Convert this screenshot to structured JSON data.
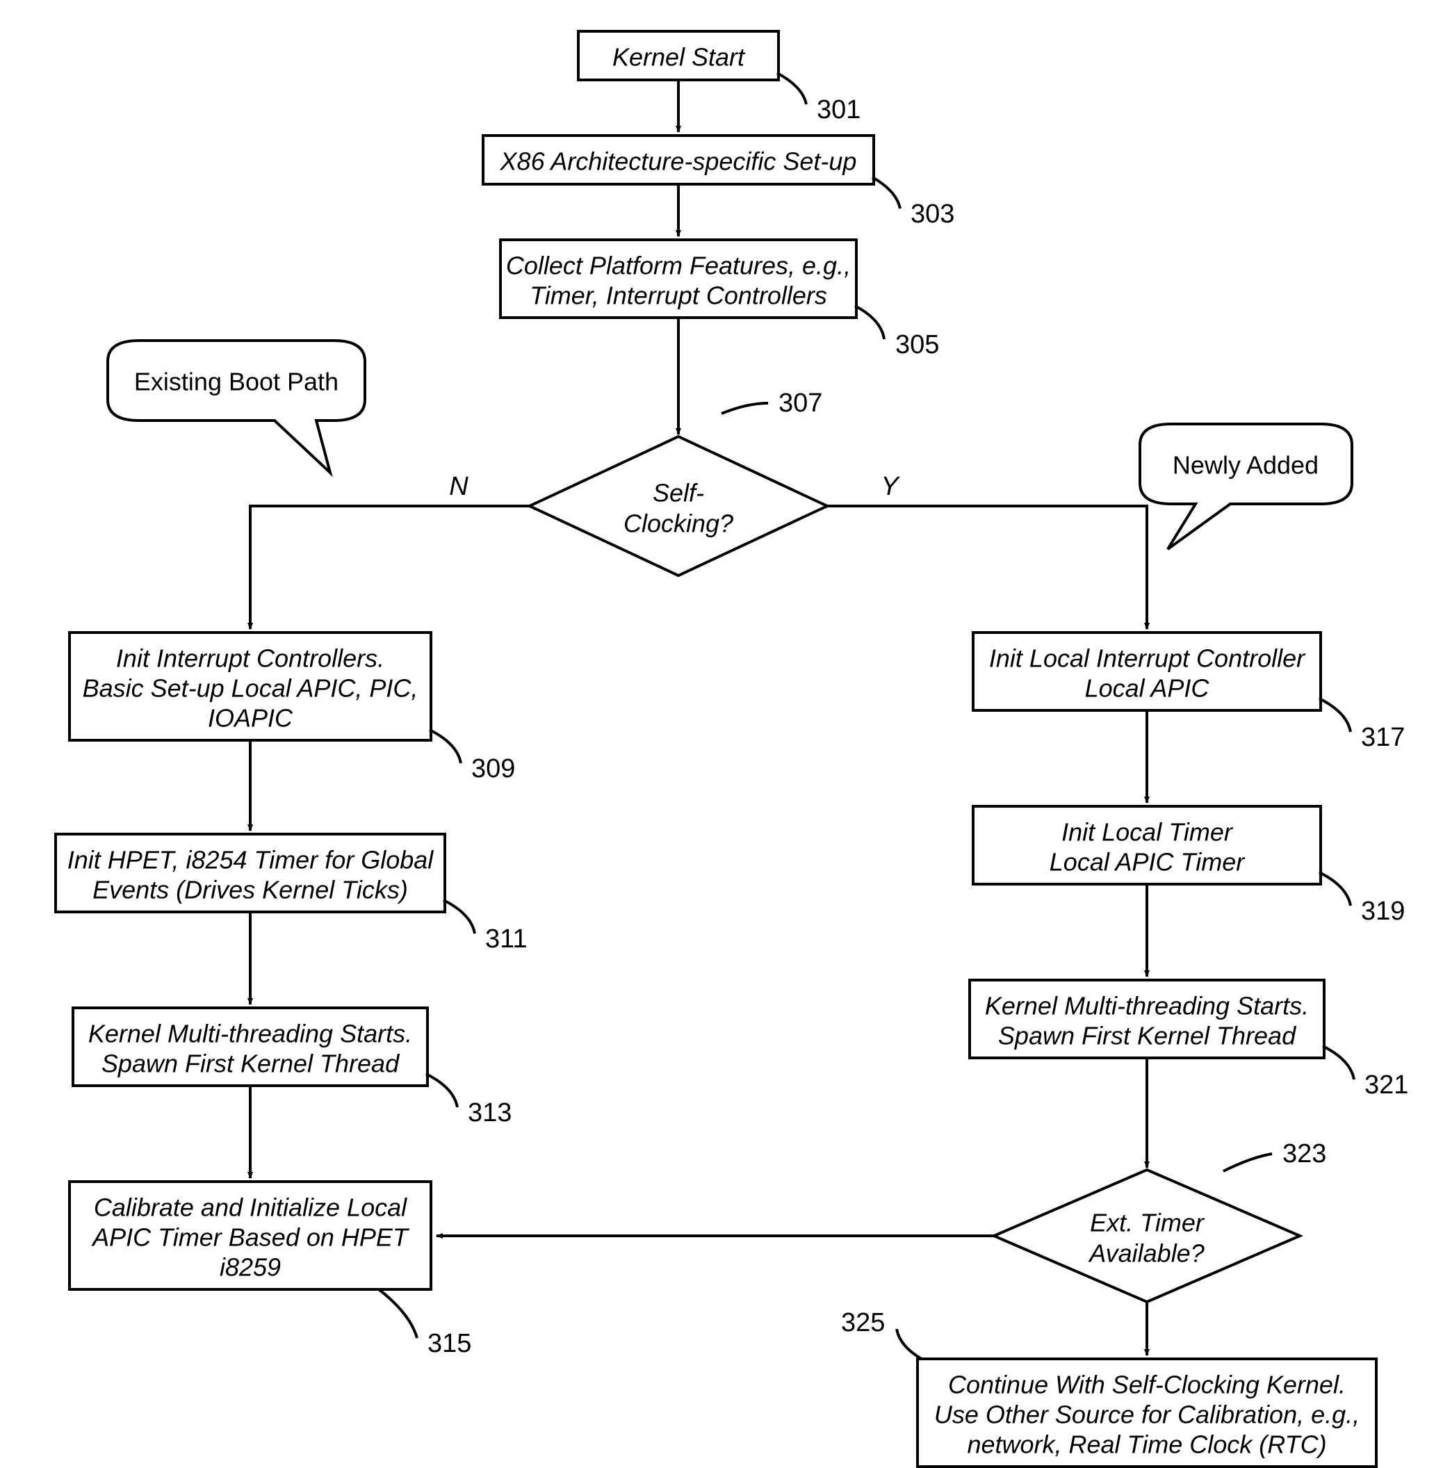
{
  "chart_data": {
    "type": "flowchart",
    "nodes": [
      {
        "id": "301",
        "type": "process",
        "text": "Kernel Start"
      },
      {
        "id": "303",
        "type": "process",
        "text": "X86 Architecture-specific Set-up"
      },
      {
        "id": "305",
        "type": "process",
        "text": "Collect Platform Features, e.g., Timer, Interrupt Controllers"
      },
      {
        "id": "307",
        "type": "decision",
        "text": "Self-Clocking?"
      },
      {
        "id": "309",
        "type": "process",
        "text": "Init Interrupt Controllers. Basic Set-up Local APIC, PIC, IOAPIC"
      },
      {
        "id": "311",
        "type": "process",
        "text": "Init HPET, i8254 Timer for Global Events (Drives Kernel Ticks)"
      },
      {
        "id": "313",
        "type": "process",
        "text": "Kernel Multi-threading Starts. Spawn First Kernel Thread"
      },
      {
        "id": "315",
        "type": "process",
        "text": "Calibrate and Initialize Local APIC Timer Based on HPET i8259"
      },
      {
        "id": "317",
        "type": "process",
        "text": "Init Local Interrupt Controller Local APIC"
      },
      {
        "id": "319",
        "type": "process",
        "text": "Init Local Timer Local APIC Timer"
      },
      {
        "id": "321",
        "type": "process",
        "text": "Kernel Multi-threading Starts. Spawn First Kernel Thread"
      },
      {
        "id": "323",
        "type": "decision",
        "text": "Ext. Timer Available?"
      },
      {
        "id": "325",
        "type": "process",
        "text": "Continue With Self-Clocking Kernel. Use Other Source for Calibration, e.g., network, Real Time Clock (RTC)"
      }
    ],
    "edges": [
      {
        "from": "301",
        "to": "303"
      },
      {
        "from": "303",
        "to": "305"
      },
      {
        "from": "305",
        "to": "307"
      },
      {
        "from": "307",
        "to": "309",
        "label": "N"
      },
      {
        "from": "307",
        "to": "317",
        "label": "Y"
      },
      {
        "from": "309",
        "to": "311"
      },
      {
        "from": "311",
        "to": "313"
      },
      {
        "from": "313",
        "to": "315"
      },
      {
        "from": "317",
        "to": "319"
      },
      {
        "from": "319",
        "to": "321"
      },
      {
        "from": "321",
        "to": "323"
      },
      {
        "from": "323",
        "to": "315"
      },
      {
        "from": "323",
        "to": "325"
      }
    ],
    "callouts": [
      {
        "text": "Existing Boot Path",
        "points_to": "N branch"
      },
      {
        "text": "Newly Added",
        "points_to": "Y branch"
      }
    ]
  },
  "boxes": {
    "b301": {
      "line1": "Kernel Start"
    },
    "b303": {
      "line1": "X86 Architecture-specific Set-up"
    },
    "b305": {
      "line1": "Collect Platform Features, e.g.,",
      "line2": "Timer, Interrupt Controllers"
    },
    "b307": {
      "line1": "Self-",
      "line2": "Clocking?"
    },
    "b309": {
      "line1": "Init Interrupt Controllers.",
      "line2": "Basic Set-up Local APIC, PIC,",
      "line3": "IOAPIC"
    },
    "b311": {
      "line1": "Init HPET, i8254 Timer for Global",
      "line2": "Events (Drives Kernel Ticks)"
    },
    "b313": {
      "line1": "Kernel Multi-threading Starts.",
      "line2": "Spawn First Kernel Thread"
    },
    "b315": {
      "line1": "Calibrate and Initialize Local",
      "line2": "APIC Timer Based on HPET",
      "line3": "i8259"
    },
    "b317": {
      "line1": "Init Local Interrupt Controller",
      "line2": "Local APIC"
    },
    "b319": {
      "line1": "Init Local Timer",
      "line2": "Local APIC Timer"
    },
    "b321": {
      "line1": "Kernel Multi-threading Starts.",
      "line2": "Spawn First Kernel Thread"
    },
    "b323": {
      "line1": "Ext. Timer",
      "line2": "Available?"
    },
    "b325": {
      "line1": "Continue With Self-Clocking Kernel.",
      "line2": "Use Other Source for Calibration, e.g.,",
      "line3": "network, Real Time Clock (RTC)"
    }
  },
  "refs": {
    "r301": "301",
    "r303": "303",
    "r305": "305",
    "r307": "307",
    "r309": "309",
    "r311": "311",
    "r313": "313",
    "r315": "315",
    "r317": "317",
    "r319": "319",
    "r321": "321",
    "r323": "323",
    "r325": "325"
  },
  "callouts": {
    "existing": "Existing Boot Path",
    "newly": "Newly Added"
  },
  "branches": {
    "no": "N",
    "yes": "Y"
  }
}
